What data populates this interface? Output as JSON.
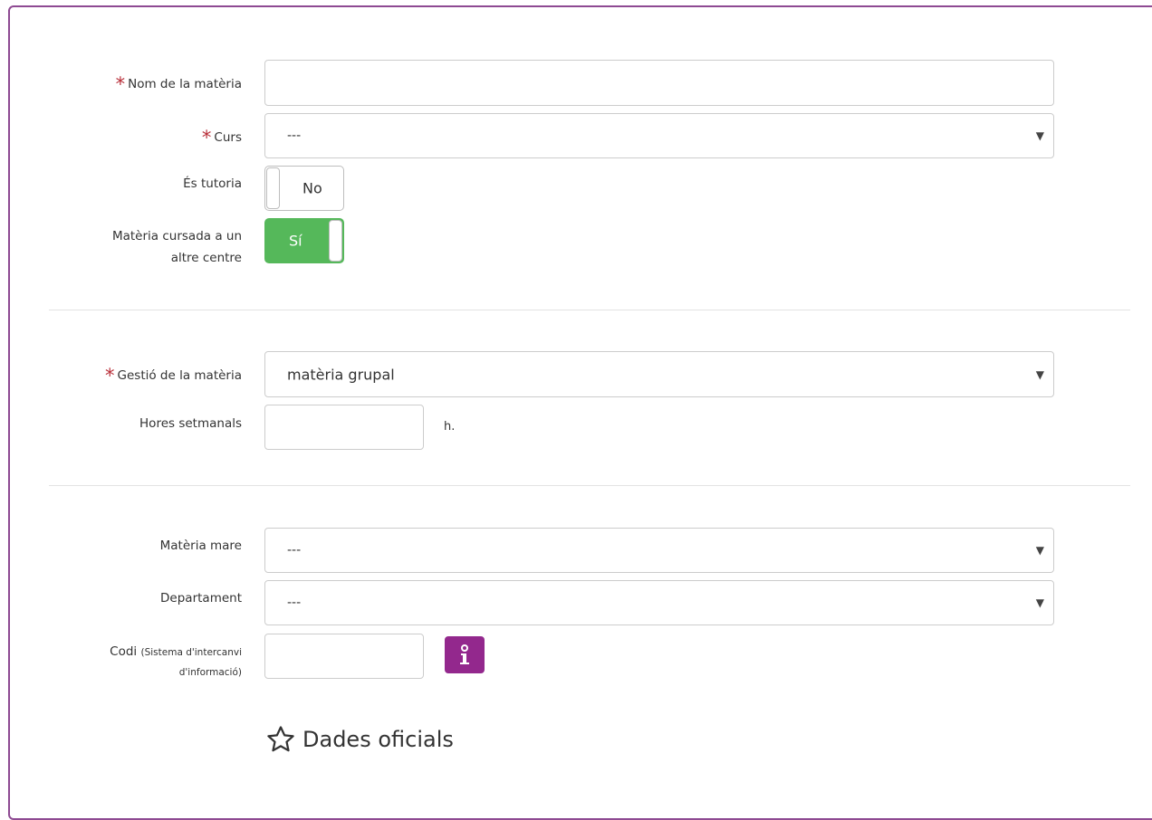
{
  "form": {
    "nom": {
      "label": "Nom de la matèria",
      "value": ""
    },
    "curs": {
      "label": "Curs",
      "value": "---"
    },
    "tutoria": {
      "label": "És tutoria",
      "state": "No"
    },
    "altre_centre": {
      "label_line1": "Matèria cursada a un",
      "label_line2": "altre centre",
      "state": "Sí"
    },
    "gestio": {
      "label": "Gestió de la matèria",
      "value": "matèria grupal"
    },
    "hores": {
      "label": "Hores setmanals",
      "value": "",
      "unit": "h."
    },
    "materia_mare": {
      "label": "Matèria mare",
      "value": "---"
    },
    "departament": {
      "label": "Departament",
      "value": "---"
    },
    "codi": {
      "label": "Codi",
      "sublabel_line1": "(Sistema d'intercanvi",
      "sublabel_line2": "d'informació)",
      "value": "",
      "info_icon": "info-icon"
    },
    "section_title": "Dades oficials",
    "section_icon": "star-outline-icon"
  },
  "colors": {
    "panel_border": "#8e4a92",
    "required_asterisk": "#b9303a",
    "toggle_on": "#55b85a",
    "info_button": "#93288d"
  }
}
